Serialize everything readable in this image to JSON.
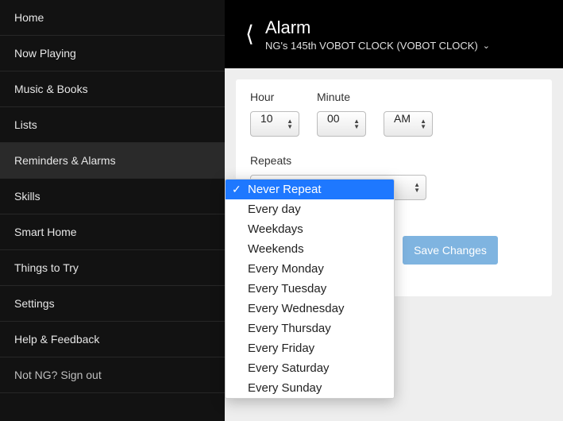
{
  "sidebar": {
    "items": [
      {
        "label": "Home"
      },
      {
        "label": "Now Playing"
      },
      {
        "label": "Music & Books"
      },
      {
        "label": "Lists"
      },
      {
        "label": "Reminders & Alarms"
      },
      {
        "label": "Skills"
      },
      {
        "label": "Smart Home"
      },
      {
        "label": "Things to Try"
      },
      {
        "label": "Settings"
      },
      {
        "label": "Help & Feedback"
      },
      {
        "label": "Not NG? Sign out"
      }
    ]
  },
  "header": {
    "title": "Alarm",
    "subtitle": "NG's 145th VOBOT CLOCK (VOBOT CLOCK)"
  },
  "form": {
    "hour_label": "Hour",
    "minute_label": "Minute",
    "hour_value": "10",
    "minute_value": "00",
    "ampm_value": "AM",
    "repeats_label": "Repeats"
  },
  "dropdown": {
    "options": [
      "Never Repeat",
      "Every day",
      "Weekdays",
      "Weekends",
      "Every Monday",
      "Every Tuesday",
      "Every Wednesday",
      "Every Thursday",
      "Every Friday",
      "Every Saturday",
      "Every Sunday"
    ]
  },
  "buttons": {
    "save": "Save Changes"
  }
}
